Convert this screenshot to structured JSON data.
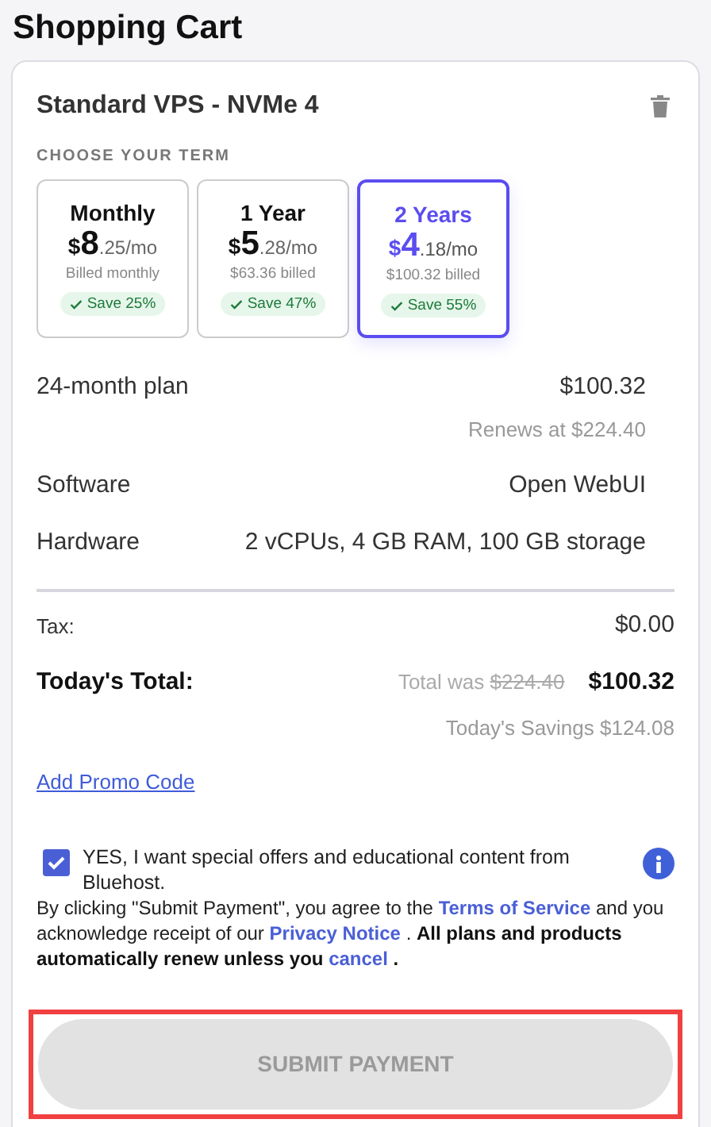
{
  "page_title": "Shopping Cart",
  "product": {
    "name": "Standard VPS - NVMe 4"
  },
  "term_heading": "CHOOSE YOUR TERM",
  "terms": [
    {
      "label": "Monthly",
      "currency": "$",
      "whole": "8",
      "rest": ".25/mo",
      "billed": "Billed monthly",
      "save": "Save 25%",
      "selected": false
    },
    {
      "label": "1 Year",
      "currency": "$",
      "whole": "5",
      "rest": ".28/mo",
      "billed": "$63.36 billed",
      "save": "Save 47%",
      "selected": false
    },
    {
      "label": "2 Years",
      "currency": "$",
      "whole": "4",
      "rest": ".18/mo",
      "billed": "$100.32 billed",
      "save": "Save 55%",
      "selected": true
    }
  ],
  "plan": {
    "label": "24-month plan",
    "price": "$100.32",
    "renews": "Renews at $224.40"
  },
  "details": [
    {
      "label": "Software",
      "value": "Open WebUI"
    },
    {
      "label": "Hardware",
      "value": "2 vCPUs, 4 GB RAM, 100 GB storage"
    }
  ],
  "tax": {
    "label": "Tax:",
    "value": "$0.00"
  },
  "total": {
    "label": "Today's Total:",
    "was_label": "Total was",
    "was_value": "$224.40",
    "value": "$100.32",
    "savings": "Today's Savings $124.08"
  },
  "promo_link": "Add Promo Code",
  "offers": {
    "checked": true,
    "text": "YES, I want special offers and educational content from Bluehost."
  },
  "legal": [
    {
      "kind": "text",
      "text": " By clicking \"Submit Payment\", you agree to the "
    },
    {
      "kind": "link",
      "text": "Terms of Service"
    },
    {
      "kind": "text",
      "text": " and you acknowledge receipt of our "
    },
    {
      "kind": "link",
      "text": "Privacy Notice"
    },
    {
      "kind": "text",
      "text": " .  "
    },
    {
      "kind": "bold",
      "text": "All plans and products automatically renew unless you "
    },
    {
      "kind": "link",
      "text": "cancel"
    },
    {
      "kind": "bold",
      "text": " ."
    }
  ],
  "submit": {
    "label": "SUBMIT PAYMENT",
    "disabled": true,
    "highlighted": true
  }
}
